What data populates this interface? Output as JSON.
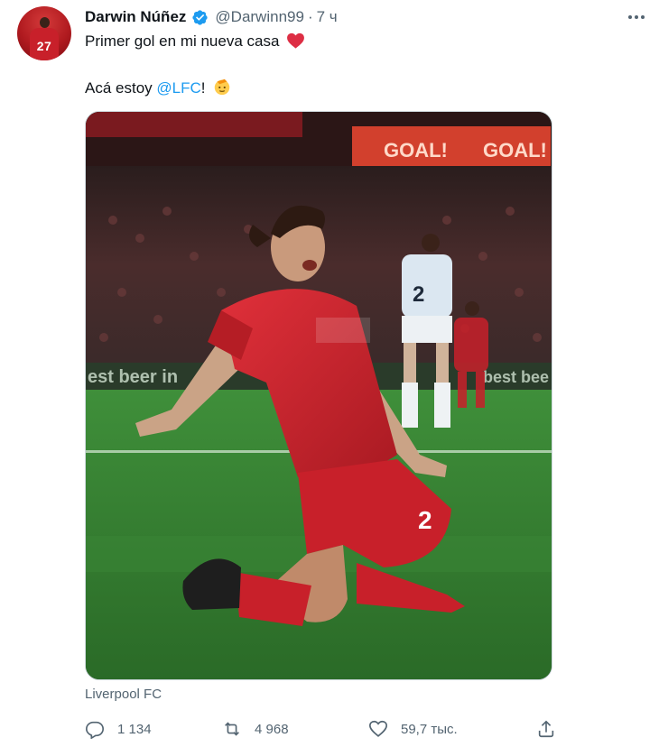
{
  "author": {
    "display_name": "Darwin Núñez",
    "handle": "@Darwinn99",
    "separator": "·",
    "time": "7 ч",
    "verified": true
  },
  "avatar": {
    "number": "27"
  },
  "tweet": {
    "line1": "Primer gol en mi nueva casa",
    "line2_prefix": "Acá estoy ",
    "mention": "@LFC",
    "line2_suffix": "!",
    "emojis": [
      "red-heart",
      "saluting-face"
    ]
  },
  "media": {
    "description_tokens": {
      "board_text_1": "GOAL!",
      "board_text_2": "GOAL!",
      "ad_text_left": "est beer in",
      "ad_text_right": "best bee",
      "player_number": "2",
      "opponent_number": "2"
    }
  },
  "media_caption": "Liverpool FC",
  "actions": {
    "replies": "1 134",
    "retweets": "4 968",
    "likes": "59,7 тыс."
  },
  "colors": {
    "accent": "#1d9bf0",
    "text_secondary": "#536471",
    "liverpool_red": "#c8202a"
  }
}
